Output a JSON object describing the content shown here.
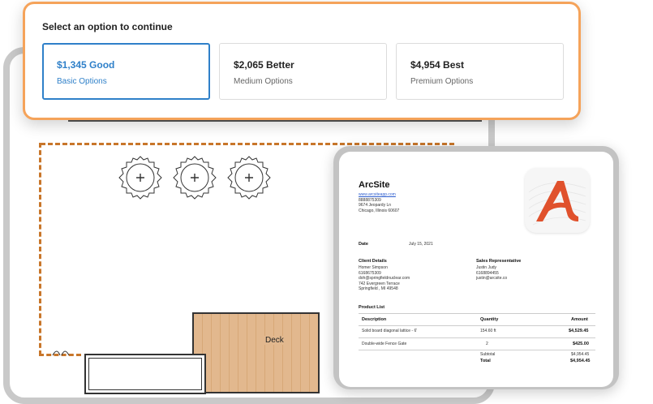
{
  "options": {
    "title": "Select an option to continue",
    "items": [
      {
        "price": "$1,345 Good",
        "label": "Basic Options",
        "selected": true
      },
      {
        "price": "$2,065 Better",
        "label": "Medium Options",
        "selected": false
      },
      {
        "price": "$4,954 Best",
        "label": "Premium Options",
        "selected": false
      }
    ]
  },
  "floorplan": {
    "deck_label": "Deck"
  },
  "estimate": {
    "company": "ArcSite",
    "website": "www.arcsiteapp.com",
    "phone": "8888875309",
    "address1": "9674 Jeopardy Ln",
    "address2": "Chicago, Illinois 60607",
    "date_label": "Date",
    "date_value": "July 15, 2021",
    "client_heading": "Client Details",
    "client_name": "Homer Simpson",
    "client_phone": "6168675309",
    "client_email": "doh@springfieldnuclear.com",
    "client_address1": "742 Evergreen Terrace",
    "client_address2": "Springfield , MI 49548",
    "rep_heading": "Sales Representative",
    "rep_name": "Justin Judy",
    "rep_phone": "6168894455",
    "rep_email": "justin@arcsite.co",
    "product_list_heading": "Product List",
    "col_description": "Description",
    "col_quantity": "Quantity",
    "col_amount": "Amount",
    "rows": [
      {
        "description": "Solid board diagonal lattice - 6'",
        "quantity": "154.60 ft",
        "amount": "$4,529.45"
      },
      {
        "description": "Double-wide Fence Gate",
        "quantity": "2",
        "amount": "$425.00"
      }
    ],
    "subtotal_label": "Subtotal",
    "subtotal_value": "$4,954.45",
    "total_label": "Total",
    "total_value": "$4,954.45"
  },
  "colors": {
    "accent_orange": "#f5a35a",
    "selected_blue": "#2f80c9",
    "logo_orange": "#e0512c"
  }
}
